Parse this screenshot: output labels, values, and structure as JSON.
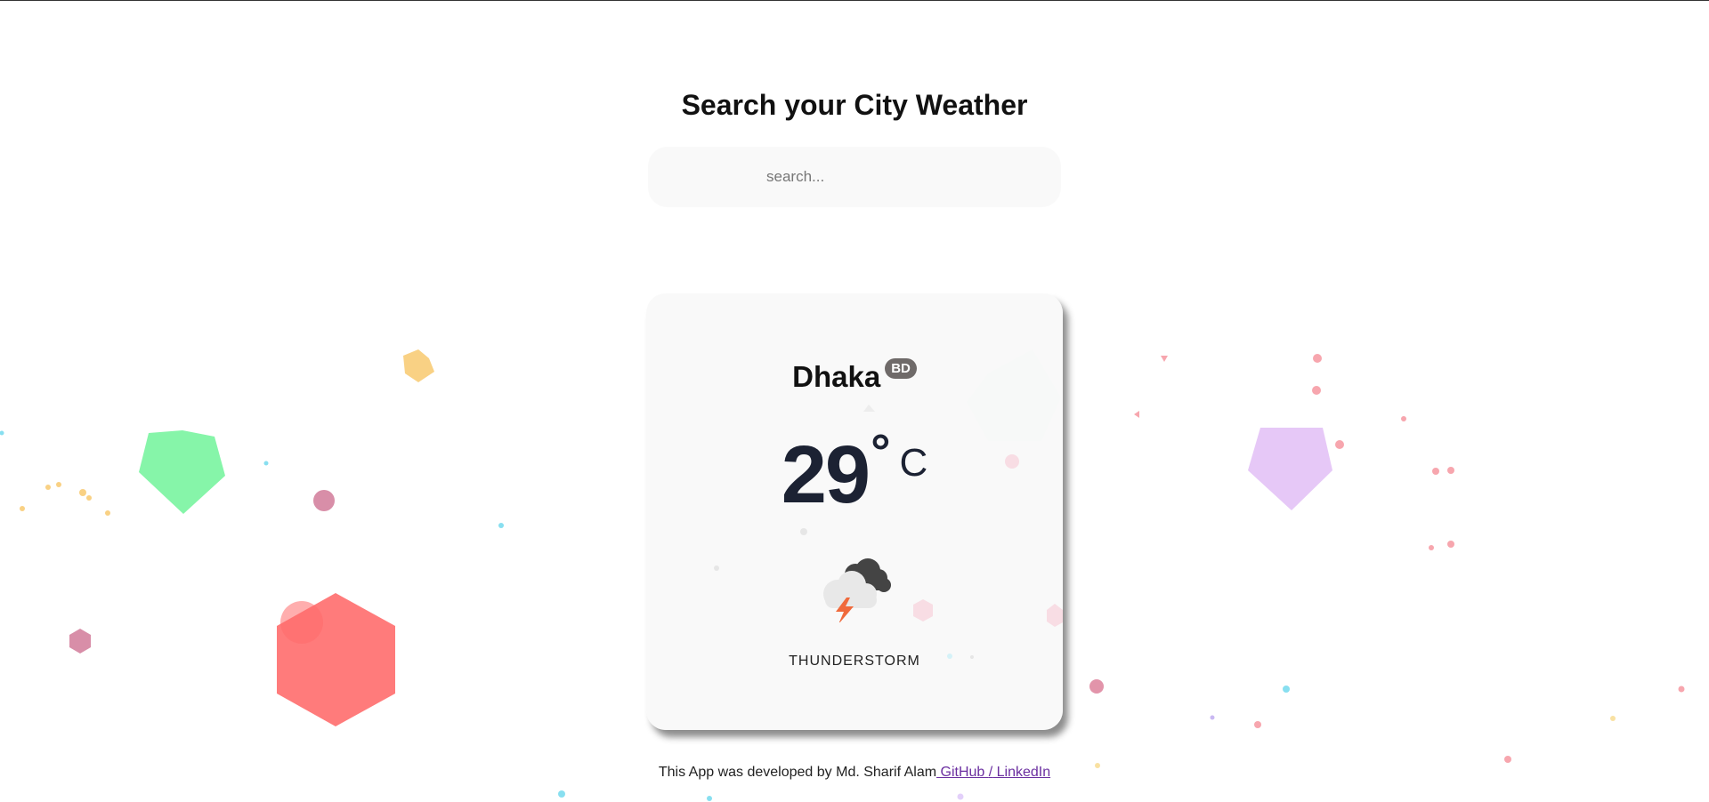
{
  "header": {
    "title": "Search your City Weather"
  },
  "search": {
    "placeholder": "search...",
    "value": ""
  },
  "weather": {
    "city": "Dhaka",
    "country": "BD",
    "temperature": "29",
    "degree_symbol": "°",
    "unit": "C",
    "condition": "THUNDERSTORM",
    "icon": "thunderstorm-icon"
  },
  "footer": {
    "text": "This App was developed by Md. Sharif Alam",
    "github_label": " GitHub ",
    "separator": "/",
    "linkedin_label": " LinkedIn"
  },
  "colors": {
    "card_background": "#f9f9f9",
    "badge_background": "#6f6a69",
    "temperature_text": "#1c2233",
    "link": "#6b2fa0"
  }
}
